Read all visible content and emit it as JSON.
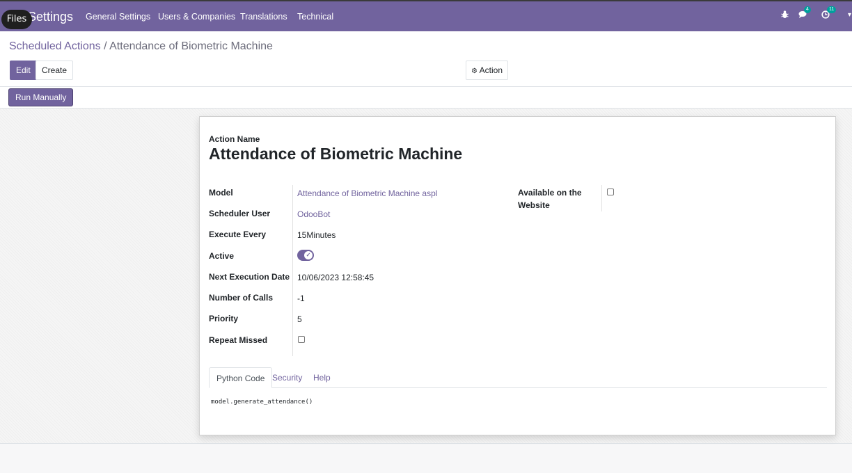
{
  "navbar": {
    "app_title": "Settings",
    "files_label": "Files",
    "menu": [
      "General Settings",
      "Users & Companies",
      "Translations",
      "Technical"
    ],
    "messages_count": "4",
    "activities_count": "11"
  },
  "breadcrumb": {
    "parent": "Scheduled Actions",
    "separator": "/",
    "current": "Attendance of Biometric Machine"
  },
  "buttons": {
    "edit": "Edit",
    "create": "Create",
    "action": "Action",
    "run_manually": "Run Manually"
  },
  "form": {
    "action_name_label": "Action Name",
    "action_name": "Attendance of Biometric Machine",
    "fields": {
      "model_label": "Model",
      "model_value": "Attendance of Biometric Machine aspl",
      "scheduler_user_label": "Scheduler User",
      "scheduler_user_value": "OdooBot",
      "execute_every_label": "Execute Every",
      "execute_every_value": "15Minutes",
      "active_label": "Active",
      "active_value": true,
      "next_execution_label": "Next Execution Date",
      "next_execution_value": "10/06/2023 12:58:45",
      "number_of_calls_label": "Number of Calls",
      "number_of_calls_value": "-1",
      "priority_label": "Priority",
      "priority_value": "5",
      "repeat_missed_label": "Repeat Missed",
      "repeat_missed_value": false,
      "available_website_label_1": "Available on the",
      "available_website_label_2": "Website",
      "available_website_value": false
    },
    "tabs": [
      "Python Code",
      "Security",
      "Help"
    ],
    "active_tab": "Python Code",
    "code": "model.generate_attendance()"
  },
  "colors": {
    "brand": "#71639e",
    "link": "#71639e"
  }
}
